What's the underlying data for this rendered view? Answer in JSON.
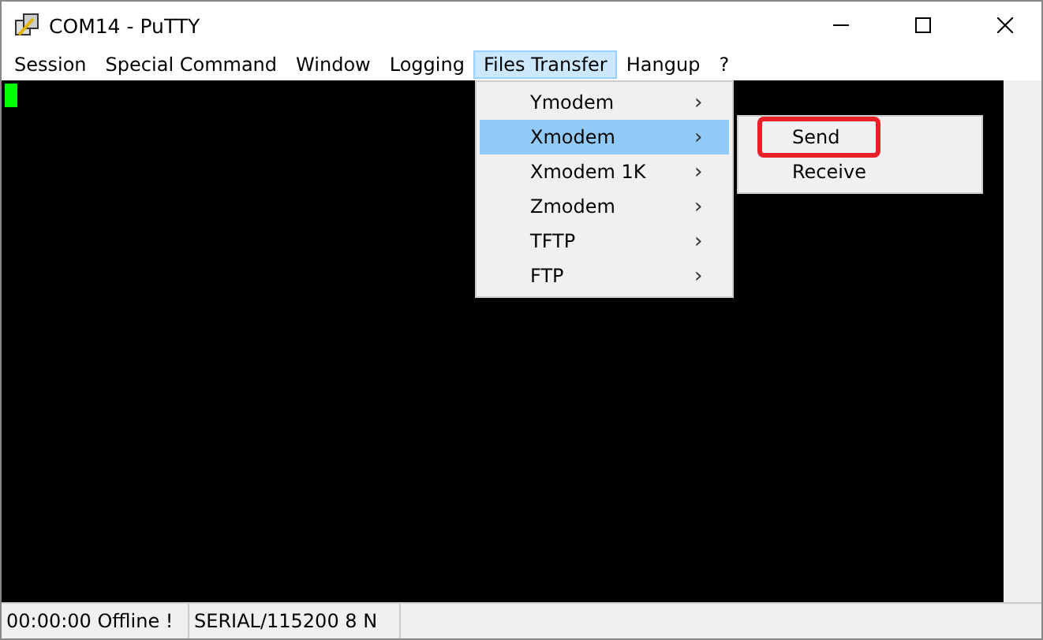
{
  "window": {
    "title": "COM14 - PuTTY"
  },
  "menu_bar": [
    {
      "label": "Session",
      "selected": false
    },
    {
      "label": "Special Command",
      "selected": false
    },
    {
      "label": "Window",
      "selected": false
    },
    {
      "label": "Logging",
      "selected": false
    },
    {
      "label": "Files Transfer",
      "selected": true
    },
    {
      "label": "Hangup",
      "selected": false
    },
    {
      "label": "?",
      "selected": false
    }
  ],
  "dropdown": {
    "items": [
      {
        "label": "Ymodem",
        "selected": false,
        "arrow": "›"
      },
      {
        "label": "Xmodem",
        "selected": true,
        "arrow": "›"
      },
      {
        "label": "Xmodem 1K",
        "selected": false,
        "arrow": "›"
      },
      {
        "label": "Zmodem",
        "selected": false,
        "arrow": "›"
      },
      {
        "label": "TFTP",
        "selected": false,
        "arrow": "›"
      },
      {
        "label": "FTP",
        "selected": false,
        "arrow": "›"
      }
    ]
  },
  "submenu": {
    "items": [
      {
        "label": "Send",
        "highlighted": true
      },
      {
        "label": "Receive",
        "highlighted": false
      }
    ]
  },
  "status_bar": [
    "00:00:00 Offline !",
    "SERIAL/115200 8 N"
  ]
}
